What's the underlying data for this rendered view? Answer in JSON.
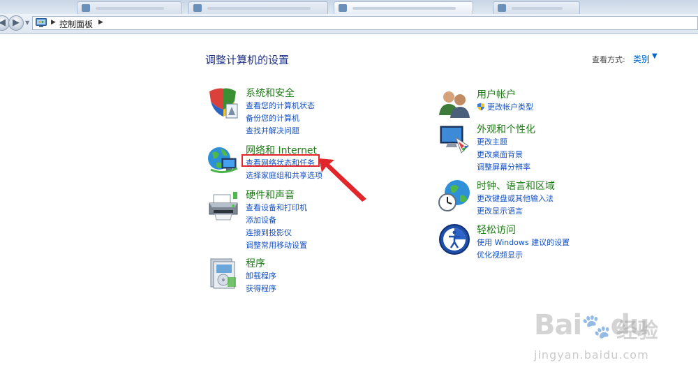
{
  "addressbar": {
    "breadcrumb": "控制面板"
  },
  "main": {
    "heading": "调整计算机的设置",
    "view_by_label": "查看方式:",
    "view_by_value": "类别"
  },
  "categories": [
    {
      "title": "系统和安全",
      "icon": "security-shield-icon",
      "links": [
        "查看您的计算机状态",
        "备份您的计算机",
        "查找并解决问题"
      ]
    },
    {
      "title": "网络和 Internet",
      "icon": "network-globe-icon",
      "links": [
        "查看网络状态和任务",
        "选择家庭组和共享选项"
      ]
    },
    {
      "title": "硬件和声音",
      "icon": "printer-icon",
      "links": [
        "查看设备和打印机",
        "添加设备",
        "连接到投影仪",
        "调整常用移动设置"
      ]
    },
    {
      "title": "程序",
      "icon": "programs-icon",
      "links": [
        "卸载程序",
        "获得程序"
      ]
    },
    {
      "title": "用户帐户",
      "icon": "users-icon",
      "links": [
        "更改帐户类型"
      ]
    },
    {
      "title": "外观和个性化",
      "icon": "monitor-palette-icon",
      "links": [
        "更改主题",
        "更改桌面背景",
        "调整屏幕分辨率"
      ]
    },
    {
      "title": "时钟、语言和区域",
      "icon": "clock-globe-icon",
      "links": [
        "更改键盘或其他输入法",
        "更改显示语言"
      ]
    },
    {
      "title": "轻松访问",
      "icon": "ease-of-access-icon",
      "links": [
        "使用 Windows 建议的设置",
        "优化视频显示"
      ]
    }
  ],
  "annotation": {
    "color": "#e0262a"
  },
  "watermark": {
    "brand": "Bai",
    "brand_suffix": "du",
    "cn": "经验",
    "url": "jingyan.baidu.com"
  },
  "colors": {
    "category_title": "#1e7a16",
    "link": "#1451c4",
    "heading": "#1e3287"
  }
}
